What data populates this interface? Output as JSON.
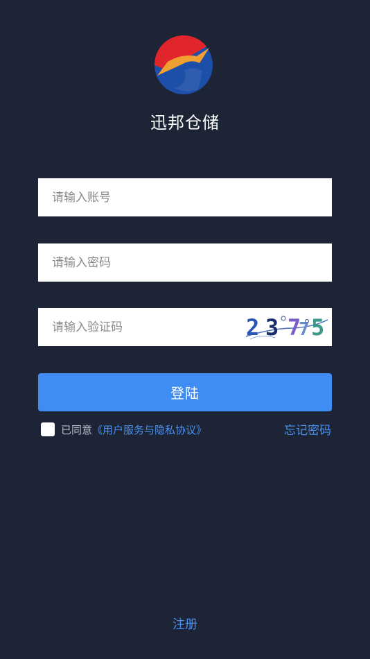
{
  "app": {
    "title": "迅邦仓储"
  },
  "form": {
    "account_placeholder": "请输入账号",
    "password_placeholder": "请输入密码",
    "captcha_placeholder": "请输入验证码",
    "captcha_code": "23775"
  },
  "login_button": "登陆",
  "agreement": {
    "prefix": "已同意",
    "link": "《用户服务与隐私协议》",
    "checked": false
  },
  "forgot_password": "忘记密码",
  "register": "注册",
  "colors": {
    "background": "#1c2436",
    "accent": "#3f8cf2",
    "link": "#4a8ff0",
    "logo_red": "#e0262c",
    "logo_orange": "#f0a030",
    "logo_blue": "#1e4fa8"
  }
}
